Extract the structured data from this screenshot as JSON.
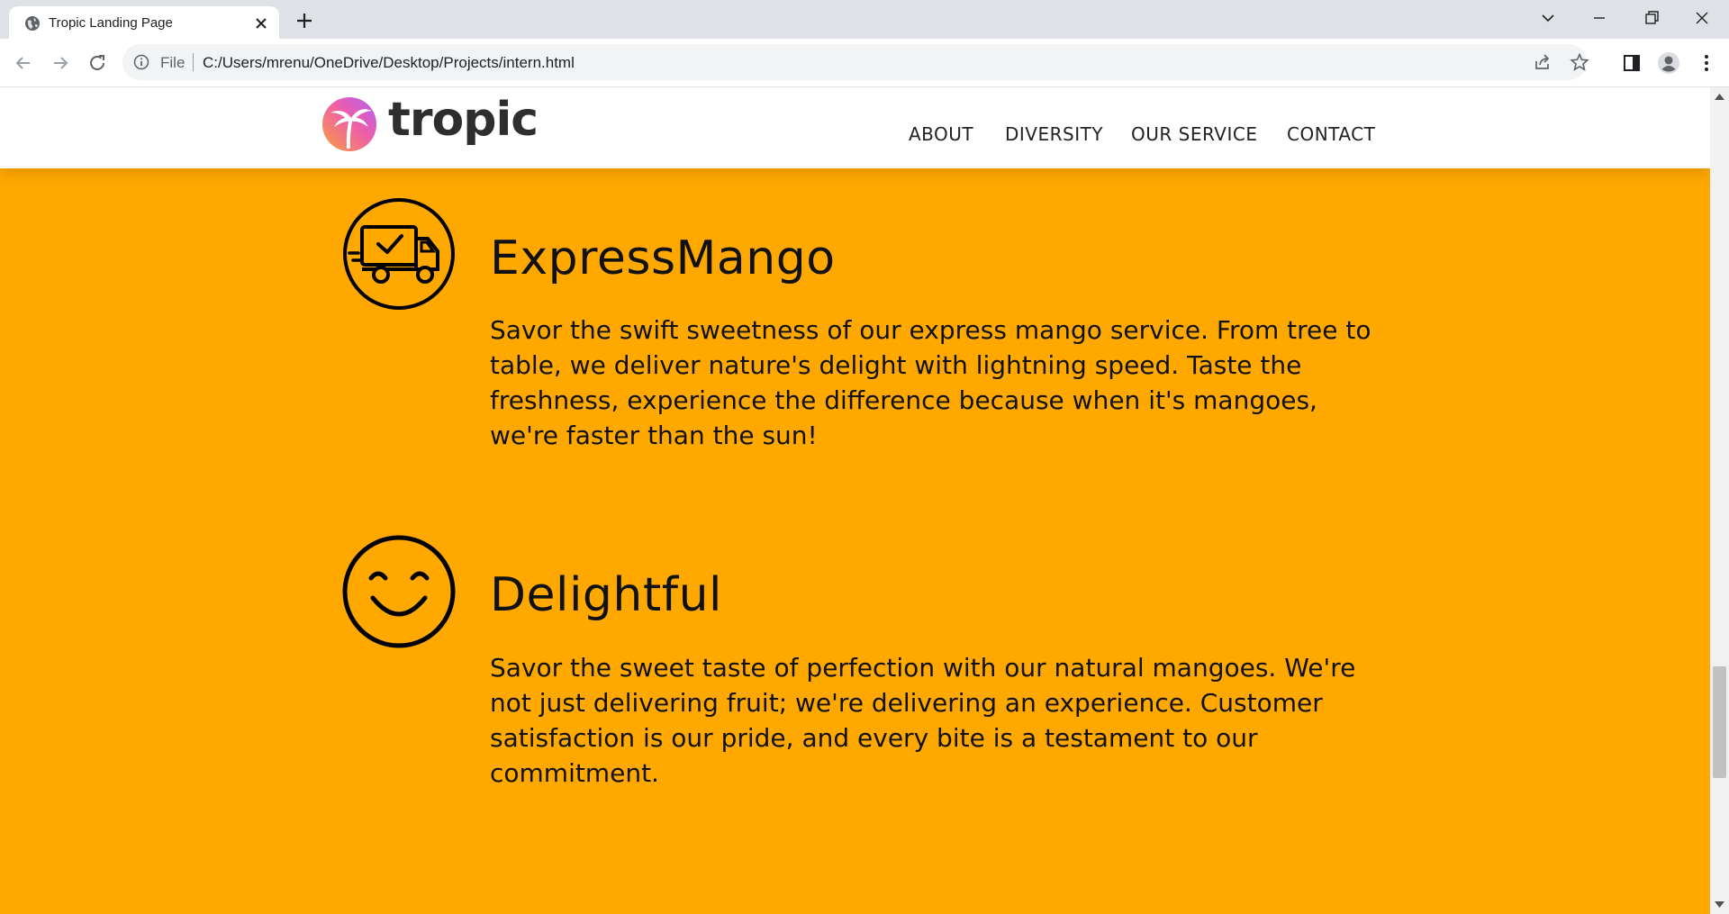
{
  "browser": {
    "tab_title": "Tropic Landing Page",
    "file_label": "File",
    "url": "C:/Users/mrenu/OneDrive/Desktop/Projects/intern.html"
  },
  "site": {
    "logo_text": "tropic",
    "nav": [
      "ABOUT",
      "DIVERSITY",
      "OUR SERVICE",
      "CONTACT"
    ]
  },
  "features": [
    {
      "icon": "delivery-truck-icon",
      "title": "ExpressMango",
      "description": "Savor the swift sweetness of our express mango service. From tree to table, we deliver nature's delight with lightning speed. Taste the freshness, experience the difference because when it's mangoes, we're faster than the sun!"
    },
    {
      "icon": "smiley-face-icon",
      "title": "Delightful",
      "description": "Savor the sweet taste of perfection with our natural mangoes. We're not just delivering fruit; we're delivering an experience. Customer satisfaction is our pride, and every bite is a testament to our commitment."
    }
  ],
  "colors": {
    "page_background": "#ffa800",
    "header_background": "#ffffff",
    "text": "#111111",
    "logo_gradient_start": "#f9a03f",
    "logo_gradient_end": "#c85af0"
  }
}
